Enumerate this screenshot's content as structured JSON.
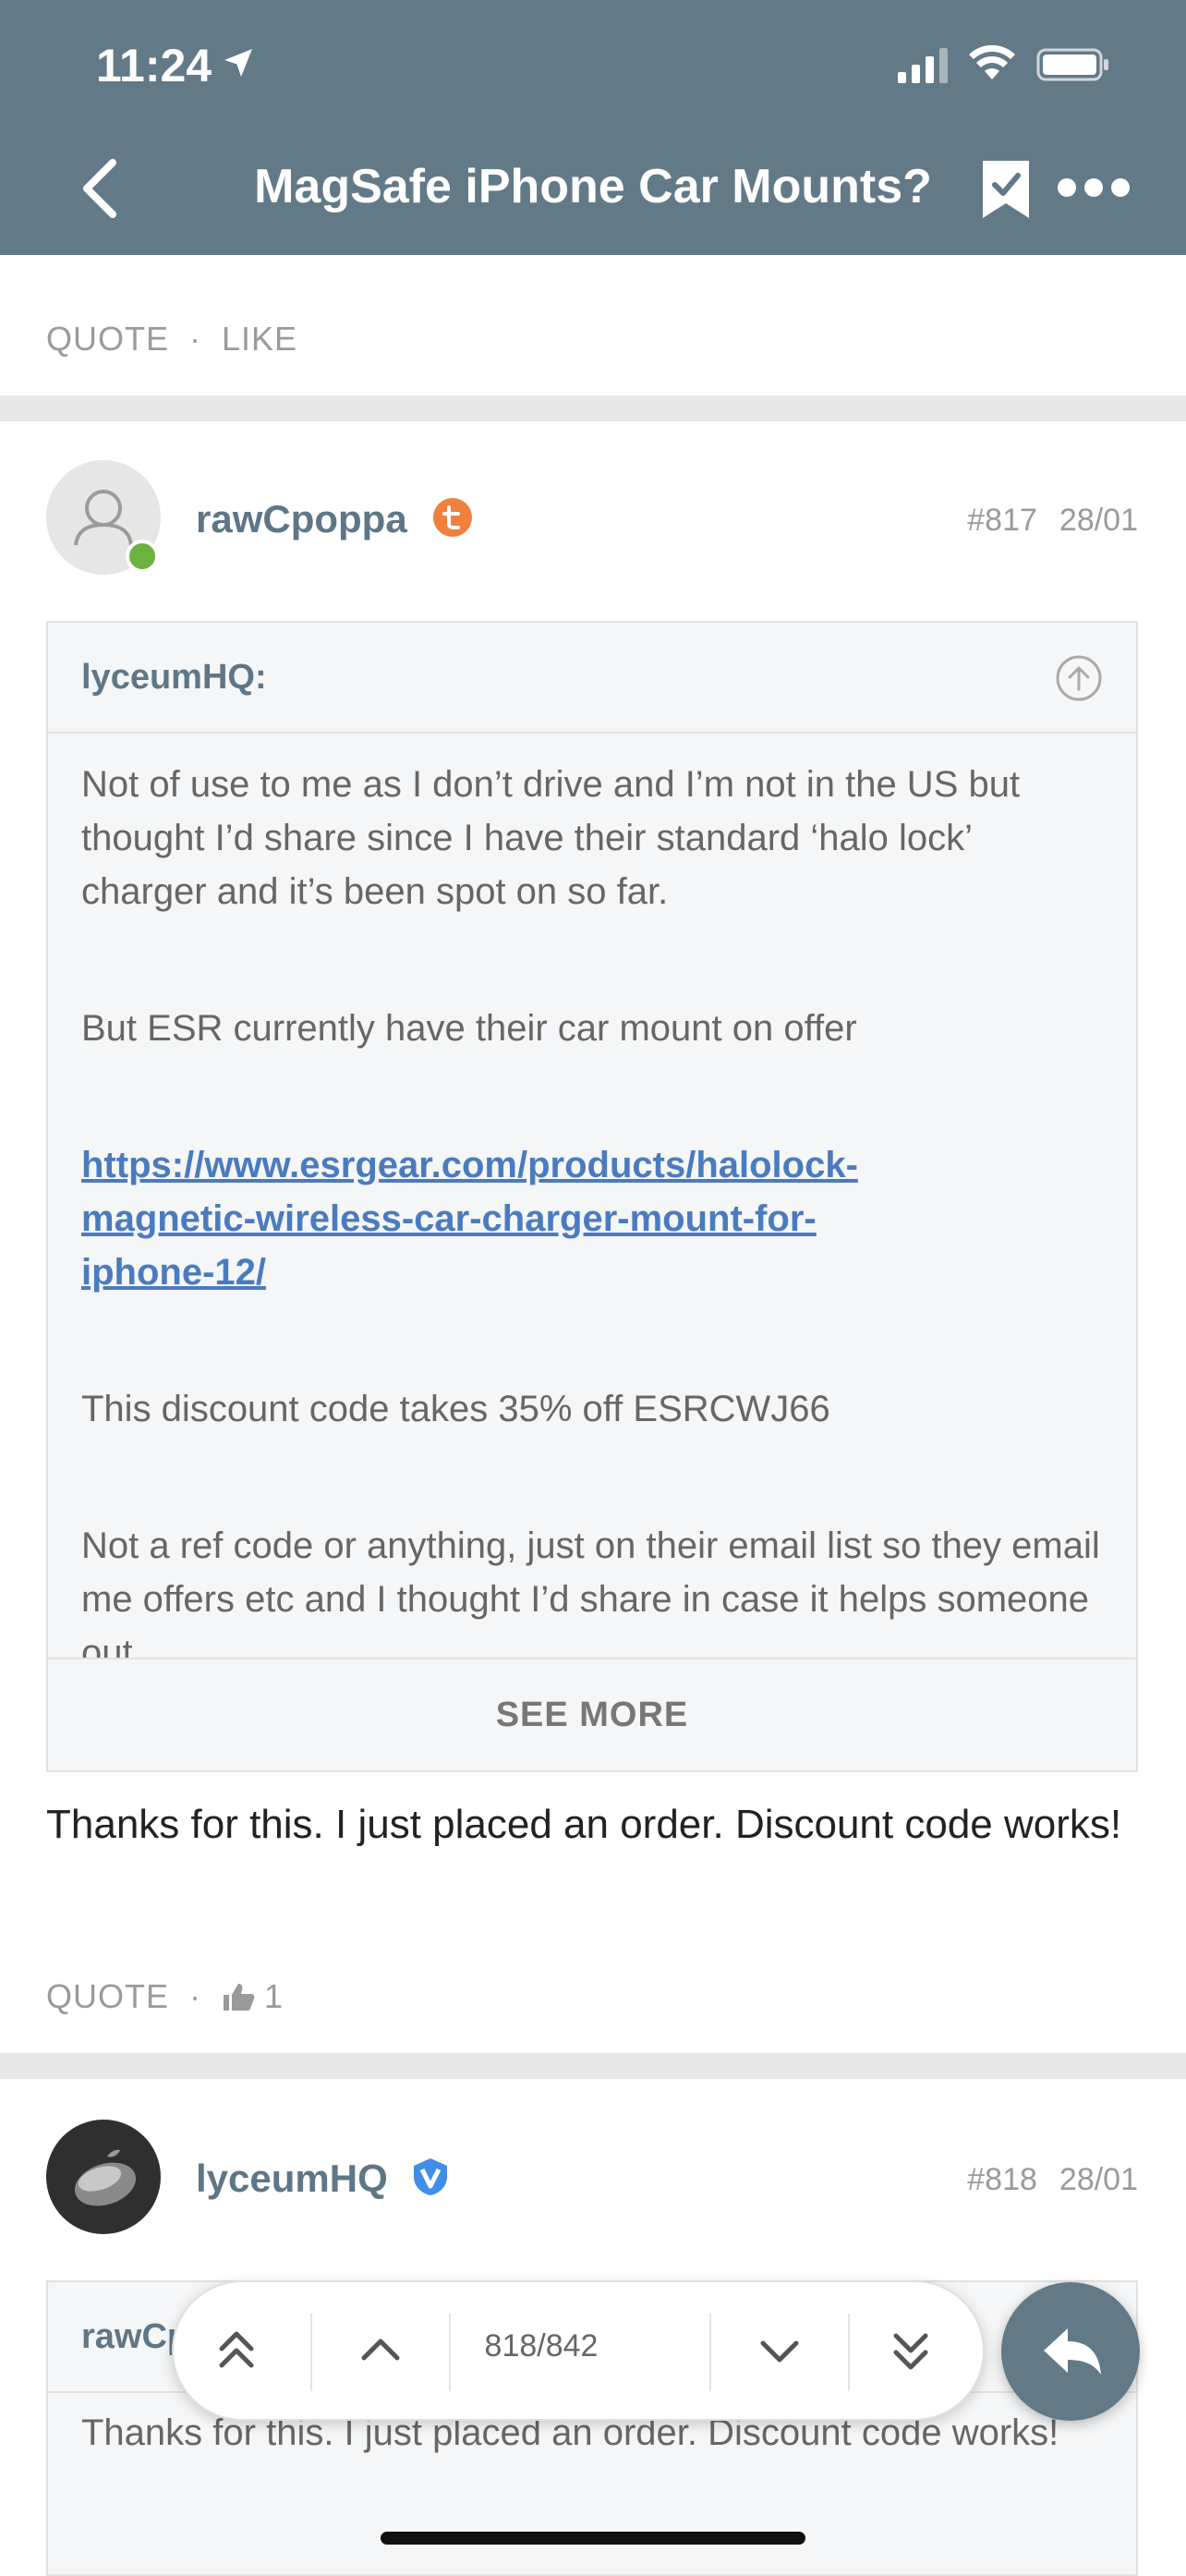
{
  "status_bar": {
    "time": "11:24"
  },
  "nav": {
    "title": "MagSafe iPhone Car Mounts?"
  },
  "top_actions": {
    "quote": "QUOTE",
    "separator": "·",
    "like": "LIKE"
  },
  "post1": {
    "username": "rawCpoppa",
    "number": "#817",
    "date": "28/01",
    "quote": {
      "author": "lyceumHQ:",
      "paragraphs": [
        "Not of use to me as I don’t drive and I’m not in the US but thought I’d share since I have their standard ‘halo lock’ charger and it’s been spot on so far.",
        "But ESR currently have their car mount on offer",
        "https://www.esrgear.com/products/halolock-magnetic-wireless-car-charger-mount-for-iphone-12/",
        "This discount code takes 35% off ESRCWJ66",
        "Not a ref code or anything, just on their email list so they email me offers etc and I thought I’d share in case it helps someone out"
      ],
      "see_more": "SEE MORE"
    },
    "text": "Thanks for this. I just placed an order. Discount code works!",
    "actions": {
      "quote": "QUOTE",
      "separator": "·",
      "like_count": "1"
    }
  },
  "post2": {
    "username": "lyceumHQ",
    "number": "#818",
    "date": "28/01",
    "quote": {
      "author": "rawCpoppa:",
      "text": "Thanks for this. I just placed an order. Discount code works!"
    }
  },
  "pager": {
    "position": "818/842"
  },
  "colors": {
    "header": "#627988",
    "link": "#4a7bbf",
    "online": "#6bb33f",
    "badge_orange": "#f0803c",
    "badge_blue": "#3f8ee8"
  }
}
